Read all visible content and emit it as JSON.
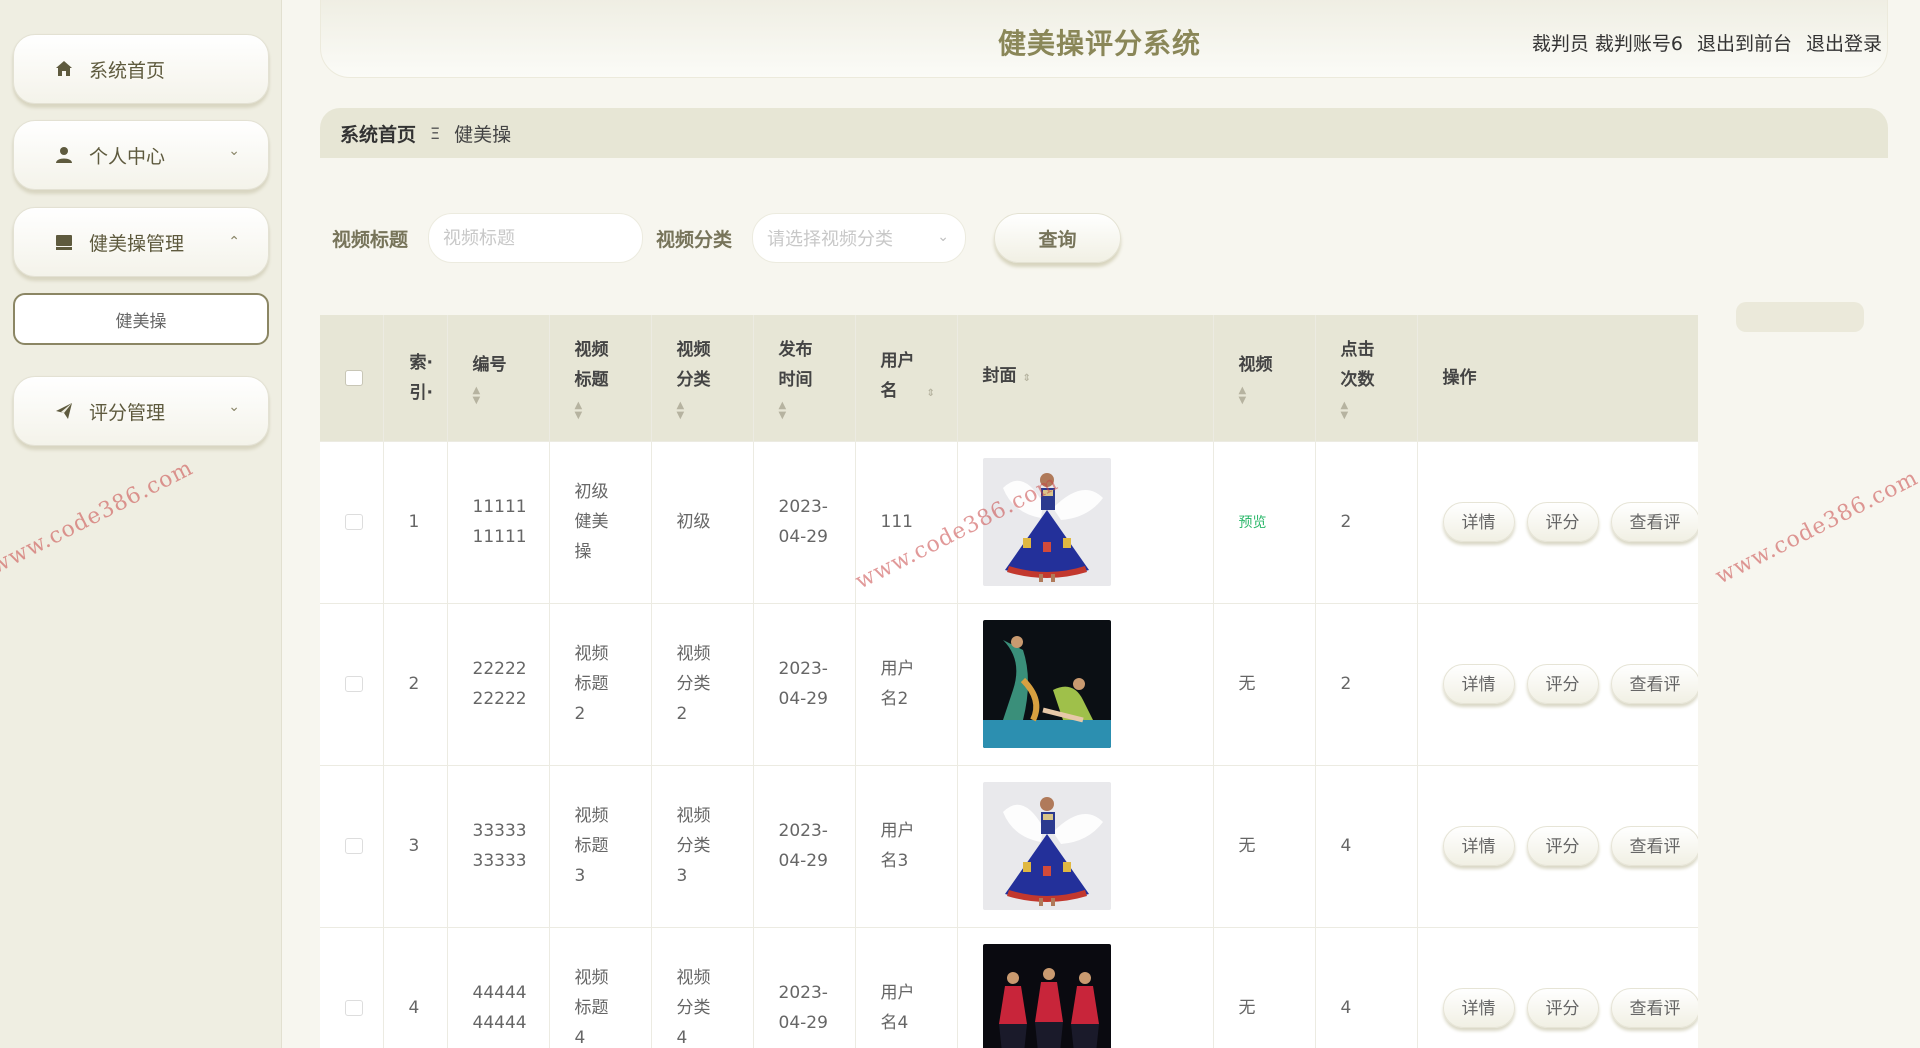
{
  "app": {
    "title": "健美操评分系统"
  },
  "user_bar": {
    "role": "裁判员",
    "account": "裁判账号6",
    "to_front": "退出到前台",
    "logout": "退出登录"
  },
  "sidebar": {
    "home": "系统首页",
    "personal": "个人中心",
    "aerobics_mgmt": "健美操管理",
    "aerobics_sub": "健美操",
    "scoring_mgmt": "评分管理"
  },
  "breadcrumb": {
    "home": "系统首页",
    "separator": "Ξ",
    "current": "健美操"
  },
  "search": {
    "title_label": "视频标题",
    "title_placeholder": "视频标题",
    "category_label": "视频分类",
    "category_placeholder": "请选择视频分类",
    "query_button": "查询"
  },
  "watermark": "www.code386.com",
  "table": {
    "headers": {
      "index": "索·引·",
      "number": "编号",
      "title": "视频标题",
      "category": "视频分类",
      "publish_time": "发布时间",
      "username": "用户名",
      "cover": "封面",
      "video": "视频",
      "clicks": "点击次数",
      "actions": "操作"
    },
    "actions": {
      "detail": "详情",
      "score": "评分",
      "view_score": "查看评"
    },
    "rows": [
      {
        "index": "1",
        "number": "11111 11111",
        "title": "初级 健美 操",
        "category": "初级",
        "publish_time": "2023- 04-29",
        "username": "111",
        "video": "预览",
        "clicks": "2",
        "cover": "dancer-blue-dress"
      },
      {
        "index": "2",
        "number": "22222 22222",
        "title": "视频 标题2",
        "category": "视频 分类2",
        "publish_time": "2023- 04-29",
        "username": "用户 名2",
        "video": "无",
        "clicks": "2",
        "cover": "dancers-dark-stage"
      },
      {
        "index": "3",
        "number": "33333 33333",
        "title": "视频 标题3",
        "category": "视频 分类3",
        "publish_time": "2023- 04-29",
        "username": "用户 名3",
        "video": "无",
        "clicks": "4",
        "cover": "dancer-blue-dress"
      },
      {
        "index": "4",
        "number": "44444 44444",
        "title": "视频 标题4",
        "category": "视频 分类4",
        "publish_time": "2023- 04-29",
        "username": "用户 名4",
        "video": "无",
        "clicks": "4",
        "cover": "dancers-red-group"
      }
    ]
  },
  "colors": {
    "accent": "#8a8758",
    "header_bg": "#e7e6d6",
    "preview_green": "#2eb86c"
  }
}
